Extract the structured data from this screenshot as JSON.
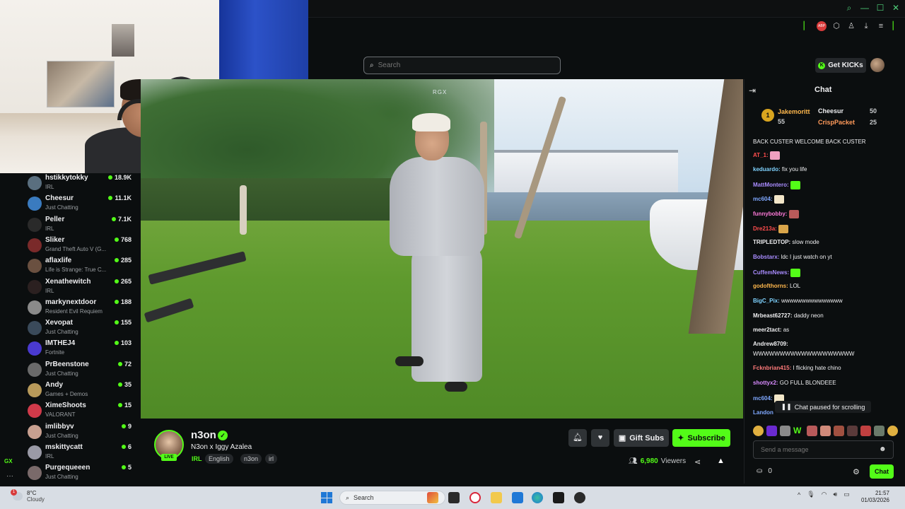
{
  "browser": {
    "ext_badge": "ABP"
  },
  "header": {
    "search_placeholder": "Search",
    "get_kicks_label": "Get KICKs"
  },
  "video": {
    "watermark": "RGX"
  },
  "sidebar": {
    "channels": [
      {
        "name": "hstikkytokky",
        "category": "IRL",
        "viewers": "18.9K",
        "color": "#5a6f7f"
      },
      {
        "name": "Cheesur",
        "category": "Just Chatting",
        "viewers": "11.1K",
        "color": "#3a7bbf"
      },
      {
        "name": "Peller",
        "category": "IRL",
        "viewers": "7.1K",
        "color": "#2a2a2a"
      },
      {
        "name": "Sliker",
        "category": "Grand Theft Auto V (G...",
        "viewers": "768",
        "color": "#7a2a2a"
      },
      {
        "name": "aflaxlife",
        "category": "Life is Strange: True C...",
        "viewers": "285",
        "color": "#6a5040"
      },
      {
        "name": "Xenathewitch",
        "category": "IRL",
        "viewers": "265",
        "color": "#2b2020"
      },
      {
        "name": "markynextdoor",
        "category": "Resident Evil Requiem",
        "viewers": "188",
        "color": "#8a8a8a"
      },
      {
        "name": "Xevopat",
        "category": "Just Chatting",
        "viewers": "155",
        "color": "#3a4a5a"
      },
      {
        "name": "IMTHEJ4",
        "category": "Fortnite",
        "viewers": "103",
        "color": "#4a3ad0"
      },
      {
        "name": "PrBeenstone",
        "category": "Just Chatting",
        "viewers": "72",
        "color": "#6a6a6a"
      },
      {
        "name": "Andy",
        "category": "Games + Demos",
        "viewers": "35",
        "color": "#b89a5a"
      },
      {
        "name": "XimeShoots",
        "category": "VALORANT",
        "viewers": "15",
        "color": "#d03a4a"
      },
      {
        "name": "imlibbyv",
        "category": "Just Chatting",
        "viewers": "9",
        "color": "#c8a090"
      },
      {
        "name": "mskittycatt",
        "category": "IRL",
        "viewers": "6",
        "color": "#9a9aa6"
      },
      {
        "name": "Purgequeeen",
        "category": "Just Chatting",
        "viewers": "5",
        "color": "#7a6a6a"
      }
    ]
  },
  "stream": {
    "streamer": "n3on",
    "live_label": "LIVE",
    "title": "N3on x Iggy Azalea",
    "category": "IRL",
    "tags": [
      "English",
      "n3on",
      "irl"
    ],
    "gift_subs_label": "Gift Subs",
    "subscribe_label": "Subscribe",
    "viewer_count": "6,980",
    "viewers_label": "Viewers"
  },
  "chat": {
    "title": "Chat",
    "leaderboard": [
      {
        "rank": "1",
        "name": "Jakemoritt",
        "points": "55"
      },
      {
        "name": "Cheesur",
        "points": "50"
      },
      {
        "name": "CrispPacket",
        "points": "25"
      }
    ],
    "messages": [
      {
        "user": "",
        "text": "BACK CUSTER WELCOME BACK CUSTER",
        "color": "#efeff1"
      },
      {
        "user": "AT_1:",
        "text": "",
        "color": "#ff4d4d",
        "emote": "#f0a0c0"
      },
      {
        "user": "keduardo:",
        "text": "fix you life",
        "color": "#7fd3ff"
      },
      {
        "user": "MattMontero:",
        "text": "",
        "color": "#a98cff",
        "emote": "#53fc18"
      },
      {
        "user": "mc604:",
        "text": "",
        "color": "#7fa8ff",
        "emote": "#f2e6c8"
      },
      {
        "user": "funnybobby:",
        "text": "",
        "color": "#ff7ad9",
        "emote": "#b85a5a"
      },
      {
        "user": "Dre213a:",
        "text": "",
        "color": "#ff4d4d",
        "emote": "#d9a54a"
      },
      {
        "user": "TRIPLEDTOP:",
        "text": "slow mode",
        "color": "#efeff1"
      },
      {
        "user": "Bobstarx:",
        "text": "ldc I just watch on yt",
        "color": "#a98cff"
      },
      {
        "user": "CuffemNews:",
        "text": "",
        "color": "#a98cff",
        "emote": "#53fc18"
      },
      {
        "user": "godofthorns:",
        "text": "LOL",
        "color": "#ffb84d"
      },
      {
        "user": "BigC_Pix:",
        "text": "wwwwwwwwwwwwwww",
        "color": "#7fd3ff"
      },
      {
        "user": "Mrbeast62727:",
        "text": "daddy neon",
        "color": "#efeff1"
      },
      {
        "user": "meer2tact:",
        "text": "as",
        "color": "#efeff1"
      },
      {
        "user": "Andrew8709:",
        "text": "",
        "color": "#efeff1"
      },
      {
        "user": "",
        "text": "WWWWWWWWWWWWWWWWWWW",
        "color": "#efeff1"
      },
      {
        "user": "Fcknbrian415:",
        "text": "I flicking hate chino",
        "color": "#ff7a7a"
      },
      {
        "user": "shottyx2:",
        "text": "GO FULL BLONDEEE",
        "color": "#d98cff"
      },
      {
        "user": "mc604:",
        "text": "",
        "color": "#7fa8ff",
        "emote": "#f2e6c8"
      },
      {
        "user": "Landon",
        "text": "",
        "color": "#7fa8ff"
      }
    ],
    "paused_label": "Chat paused for scrolling",
    "input_placeholder": "Send a message",
    "points_value": "0",
    "send_label": "Chat"
  },
  "taskbar": {
    "weather_temp": "8°C",
    "weather_desc": "Cloudy",
    "notification_count": "1",
    "search_placeholder": "Search",
    "time": "21:57",
    "date": "01/03/2026"
  }
}
